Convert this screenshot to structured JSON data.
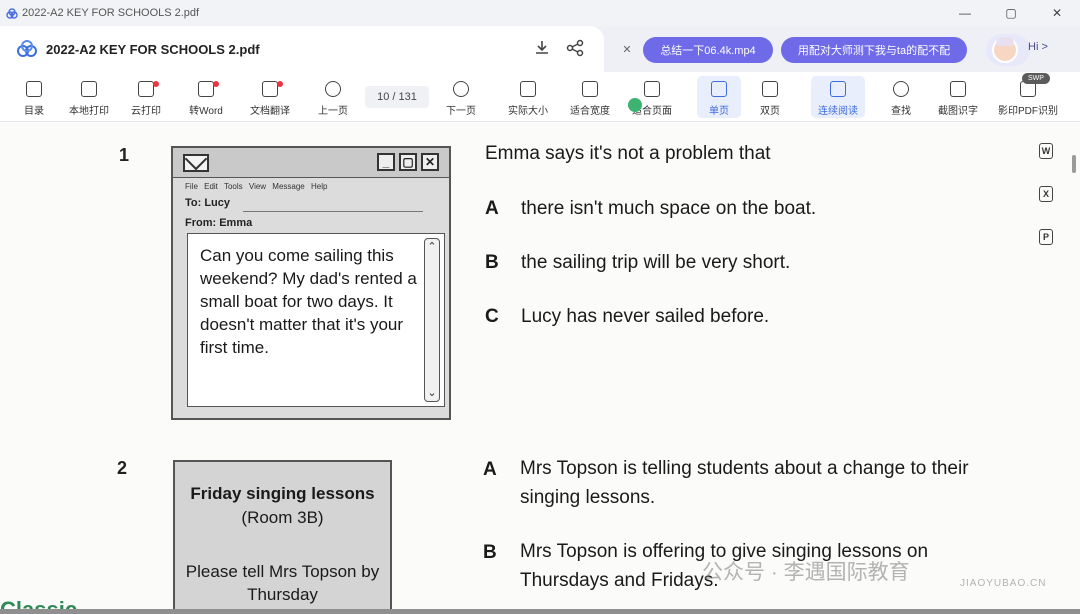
{
  "window": {
    "title": "2022-A2 KEY FOR SCHOOLS 2.pdf",
    "controls": [
      "—",
      "▢",
      "✕"
    ]
  },
  "tab": {
    "title": "2022-A2 KEY FOR SCHOOLS 2.pdf",
    "pill1": "总结一下06.4k.mp4",
    "pill2": "用配对大师测下我与ta的配不配",
    "hi": "Hi >"
  },
  "toolbar": {
    "items": [
      {
        "label": "目录",
        "icon": "toc-icon"
      },
      {
        "label": "本地打印",
        "icon": "printer-icon"
      },
      {
        "label": "云打印",
        "icon": "cloud-print-icon"
      },
      {
        "label": "转Word",
        "icon": "word-icon"
      },
      {
        "label": "文档翻译",
        "icon": "translate-icon"
      },
      {
        "label": "上一页",
        "icon": "prev-page-icon"
      },
      {
        "label": "下一页",
        "icon": "next-page-icon"
      },
      {
        "label": "实际大小",
        "icon": "actual-size-icon"
      },
      {
        "label": "适合宽度",
        "icon": "fit-width-icon"
      },
      {
        "label": "适合页面",
        "icon": "fit-page-icon"
      },
      {
        "label": "单页",
        "icon": "single-page-icon"
      },
      {
        "label": "双页",
        "icon": "double-page-icon"
      },
      {
        "label": "连续阅读",
        "icon": "continuous-icon"
      },
      {
        "label": "查找",
        "icon": "search-icon"
      },
      {
        "label": "截图识字",
        "icon": "screenshot-ocr-icon"
      },
      {
        "label": "影印PDF识别",
        "icon": "ocr-pdf-icon"
      }
    ],
    "page_indicator": "10 / 131",
    "badge": "SWP"
  },
  "q1": {
    "number": "1",
    "stem": "Emma says it's not a problem that",
    "email": {
      "menu": "File Edit Tools View Message Help",
      "to": "To: Lucy",
      "from": "From: Emma",
      "message": "Can you come sailing this weekend? My dad's rented a small boat for two days. It doesn't matter that it's your first time."
    },
    "options": [
      {
        "letter": "A",
        "text": "there isn't much space on the boat."
      },
      {
        "letter": "B",
        "text": "the sailing trip will be very short."
      },
      {
        "letter": "C",
        "text": "Lucy has never sailed before."
      }
    ]
  },
  "q2": {
    "number": "2",
    "notice": {
      "title": "Friday singing lessons",
      "room": "(Room 3B)",
      "body": "Please tell Mrs Topson by Thursday"
    },
    "options": [
      {
        "letter": "A",
        "text": "Mrs Topson is telling students about a change to their singing lessons."
      },
      {
        "letter": "B",
        "text": "Mrs Topson is offering to give singing lessons on Thursdays and Fridays."
      }
    ]
  },
  "watermark": {
    "main": "公众号 · 李遇国际教育",
    "sub": "JIAOYUBAO.CN"
  },
  "corner_text": "Classic",
  "side_buttons": [
    "W",
    "X",
    "P"
  ]
}
